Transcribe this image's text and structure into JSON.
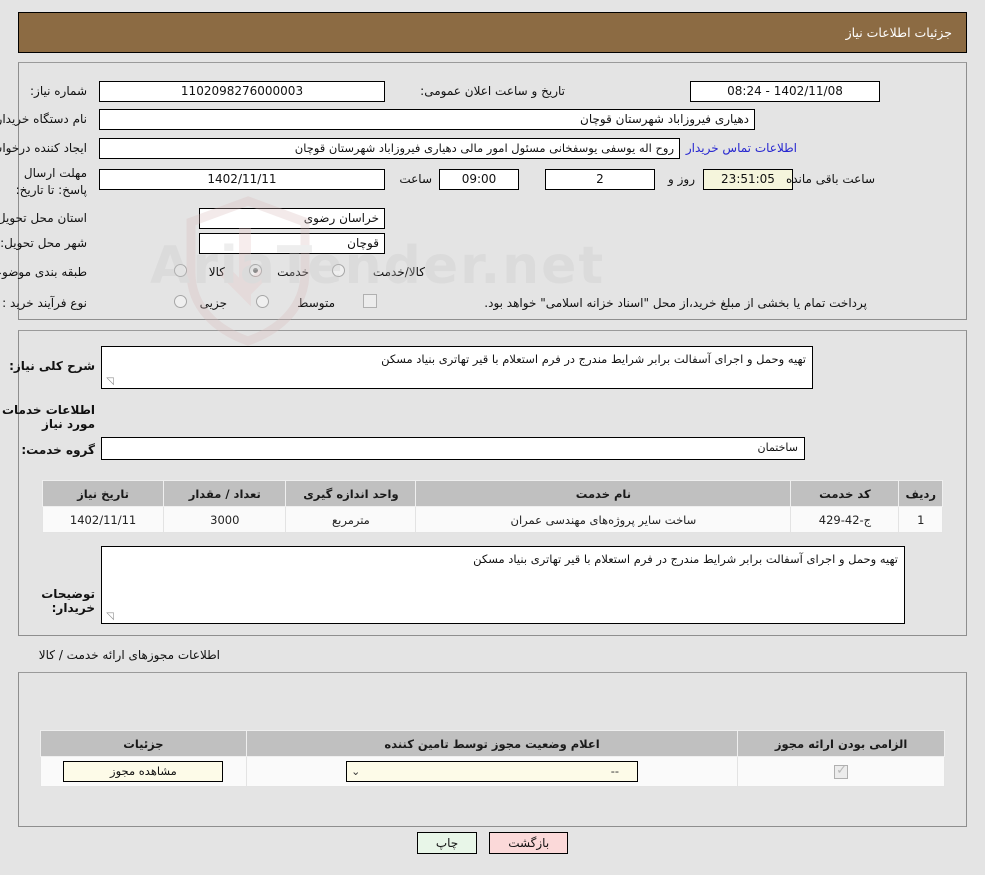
{
  "header": {
    "title": "جزئیات اطلاعات نیاز"
  },
  "top_form": {
    "need_number_label": "شماره نیاز:",
    "need_number_value": "1102098276000003",
    "announce_label": "تاریخ و ساعت اعلان عمومی:",
    "announce_value": "1402/11/08 - 08:24",
    "buyer_org_label": "نام دستگاه خریدار:",
    "buyer_org_value": "دهیاری فیروزاباد شهرستان قوچان",
    "creator_label": "ایجاد کننده درخواست:",
    "creator_value": "روح اله یوسفی یوسفخانی مسئول امور مالی دهیاری فیروزاباد شهرستان قوچان",
    "contact_link": "اطلاعات تماس خریدار",
    "deadline_label": "مهلت ارسال پاسخ: تا تاریخ:",
    "deadline_date": "1402/11/11",
    "hour_label": "ساعت",
    "hour_value": "09:00",
    "days_value": "2",
    "days_label": "روز و",
    "remaining_value": "23:51:05",
    "remaining_label": "ساعت باقی مانده",
    "province_label": "استان محل تحویل:",
    "province_value": "خراسان رضوی",
    "city_label": "شهر محل تحویل:",
    "city_value": "قوچان",
    "category_label": "طبقه بندی موضوعی:",
    "category_options": [
      "کالا",
      "خدمت",
      "کالا/خدمت"
    ],
    "category_selected": "خدمت",
    "purchase_type_label": "نوع فرآیند خرید :",
    "purchase_type_options": [
      "جزیی",
      "متوسط"
    ],
    "purchase_type_selected": "",
    "treasury_checkbox_label": "پرداخت تمام یا بخشی از مبلغ خرید،از محل \"اسناد خزانه اسلامی\" خواهد بود.",
    "treasury_checked": false
  },
  "need_section": {
    "summary_label": "شرح کلی نیاز:",
    "summary_value": "تهیه وحمل و اجرای آسفالت برابر شرایط مندرج در فرم استعلام با قیر تهاتری بنیاد مسکن",
    "services_title": "اطلاعات خدمات مورد نیاز",
    "service_group_label": "گروه خدمت:",
    "service_group_value": "ساختمان",
    "table": {
      "columns": [
        "ردیف",
        "کد خدمت",
        "نام خدمت",
        "واحد اندازه گیری",
        "تعداد / مقدار",
        "تاریخ نیاز"
      ],
      "rows": [
        [
          "1",
          "ج-42-429",
          "ساخت سایر پروژه‌های مهندسی عمران",
          "مترمربع",
          "3000",
          "1402/11/11"
        ]
      ]
    },
    "buyer_notes_label": "توضیحات خریدار:",
    "buyer_notes_value": "تهیه وحمل و اجرای آسفالت برابر شرایط مندرج در فرم استعلام با قیر تهاتری بنیاد مسکن"
  },
  "permits_section": {
    "title": "اطلاعات مجوزهای ارائه خدمت / کالا",
    "table": {
      "columns": [
        "الزامی بودن ارائه مجوز",
        "اعلام وضعیت مجوز توسط تامین کننده",
        "جزئیات"
      ],
      "rows": [
        {
          "required_checked": true,
          "status_value": "--",
          "details_button": "مشاهده مجوز"
        }
      ]
    }
  },
  "footer": {
    "print_label": "چاپ",
    "back_label": "بازگشت"
  },
  "watermark": {
    "text": "AriaTender.net"
  }
}
